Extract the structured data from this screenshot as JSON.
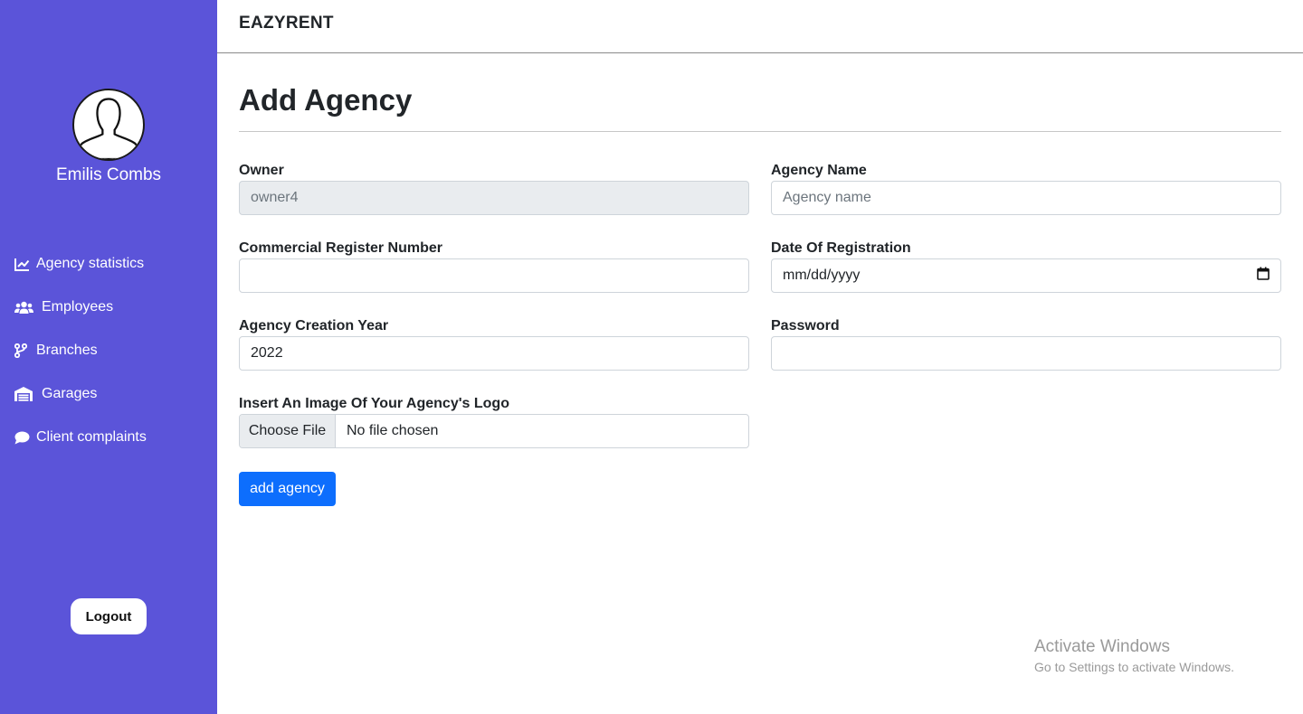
{
  "app": {
    "brand": "EAZYRENT"
  },
  "sidebar": {
    "user_name": "Emilis Combs",
    "items": [
      {
        "label": "Agency statistics",
        "icon": "line-chart-icon"
      },
      {
        "label": "Employees",
        "icon": "users-icon"
      },
      {
        "label": "Branches",
        "icon": "code-branch-icon"
      },
      {
        "label": "Garages",
        "icon": "warehouse-icon"
      },
      {
        "label": "Client complaints",
        "icon": "comment-icon"
      }
    ],
    "logout_label": "Logout",
    "background": "#5b54d9"
  },
  "page": {
    "title": "Add Agency",
    "form": {
      "owner": {
        "label": "Owner",
        "value": "owner4"
      },
      "agency_name": {
        "label": "Agency Name",
        "placeholder": "Agency name"
      },
      "register_number": {
        "label": "Commercial Register Number",
        "value": ""
      },
      "registration_date": {
        "label": "Date Of Registration",
        "value": "mm/dd/yyyy"
      },
      "creation_year": {
        "label": "Agency Creation Year",
        "value": "2022"
      },
      "password": {
        "label": "Password",
        "value": ""
      },
      "logo": {
        "label": "Insert An Image Of Your Agency's Logo",
        "button": "Choose File",
        "status": "No file chosen"
      },
      "submit_label": "add agency",
      "submit_color": "#0d6efd"
    }
  },
  "watermark": {
    "title": "Activate Windows",
    "subtitle": "Go to Settings to activate Windows."
  }
}
